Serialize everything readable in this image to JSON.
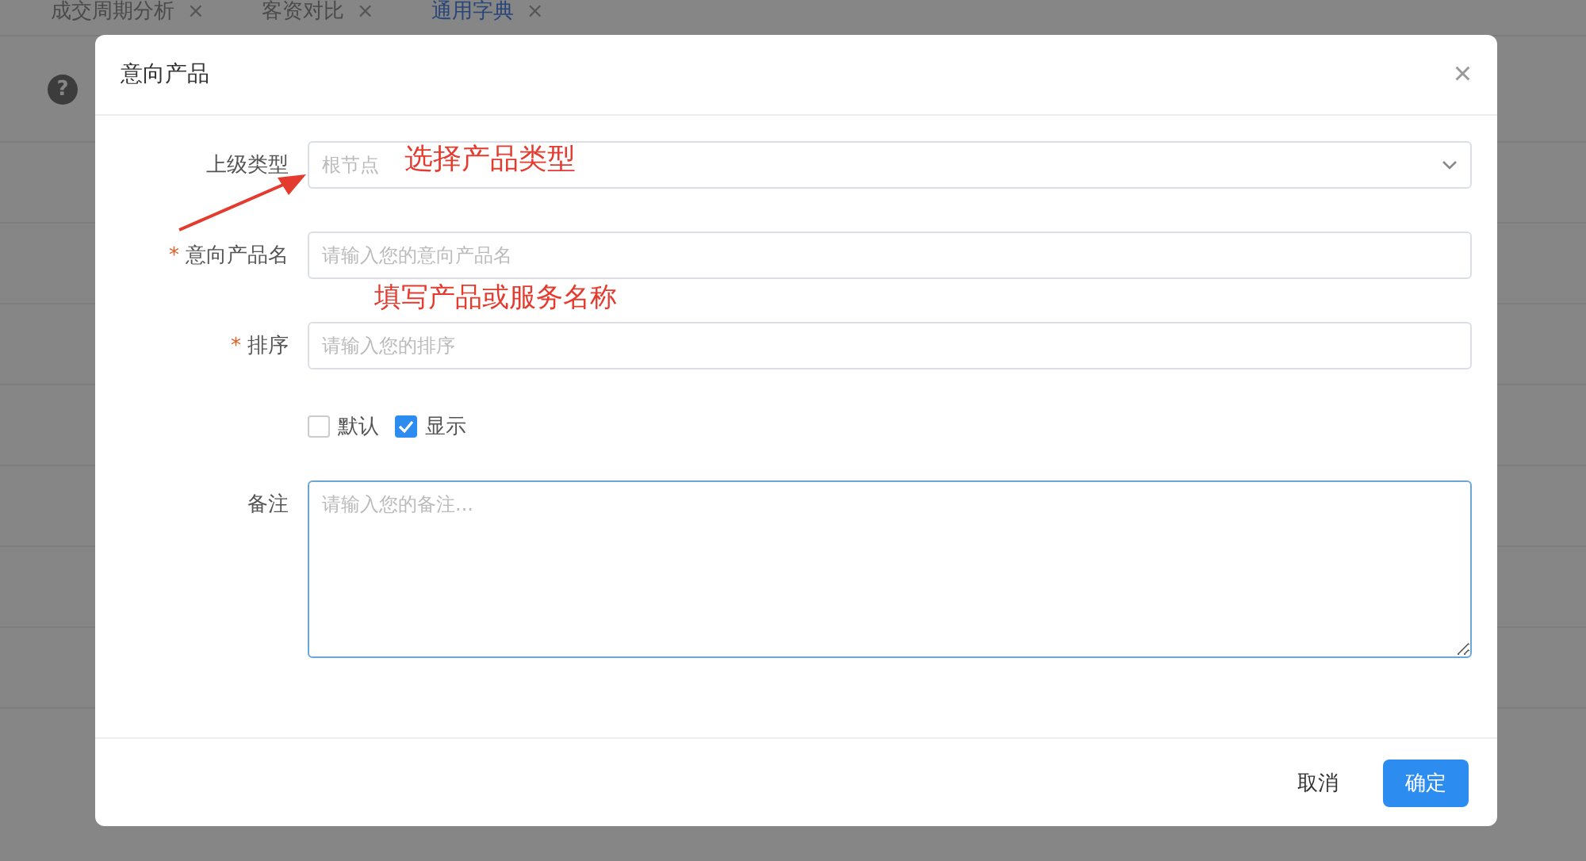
{
  "tabs": [
    {
      "label": "成交周期分析",
      "close": "×",
      "selected": false
    },
    {
      "label": "客资对比",
      "close": "×",
      "selected": false
    },
    {
      "label": "通用字典",
      "close": "×",
      "selected": true
    }
  ],
  "page": {
    "help_icon": "?"
  },
  "dialog": {
    "title": "意向产品",
    "close": "×",
    "fields": [
      {
        "kind": "select",
        "label": "上级类型",
        "placeholder": "根节点"
      },
      {
        "kind": "input",
        "label": "意向产品名",
        "required_mark": "*",
        "placeholder": "请输入您的意向产品名"
      },
      {
        "kind": "input",
        "label": "排序",
        "required_mark": "*",
        "placeholder": "请输入您的排序"
      },
      {
        "kind": "checkboxes",
        "options": [
          {
            "label": "默认",
            "checked": false
          },
          {
            "label": "显示",
            "checked": true
          }
        ]
      },
      {
        "kind": "textarea",
        "label": "备注",
        "placeholder": "请输入您的备注..."
      }
    ],
    "buttons": [
      {
        "label": "取消",
        "kind": "text"
      },
      {
        "label": "确定",
        "kind": "primary"
      }
    ]
  },
  "annotations": [
    {
      "kind": "text",
      "text": "选择产品类型"
    },
    {
      "kind": "arrow"
    },
    {
      "kind": "text",
      "text": "填写产品或服务名称"
    }
  ]
}
